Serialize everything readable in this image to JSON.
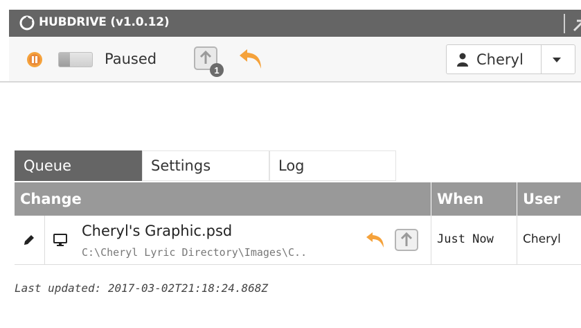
{
  "app": {
    "title": "HUBDRIVE (v1.0.12)"
  },
  "toolbar": {
    "status": "Paused",
    "upload_badge_count": "1",
    "user_name": "Cheryl"
  },
  "tabs": [
    {
      "label": "Queue",
      "active": true
    },
    {
      "label": "Settings",
      "active": false
    },
    {
      "label": "Log",
      "active": false
    }
  ],
  "table": {
    "columns": [
      "Change",
      "When",
      "User"
    ],
    "rows": [
      {
        "file_name": "Cheryl's Graphic.psd",
        "file_path": "C:\\Cheryl Lyric Directory\\Images\\C..",
        "when": "Just Now",
        "user": "Cheryl"
      }
    ]
  },
  "footer": {
    "last_updated": "Last updated: 2017-03-02T21:18:24.868Z"
  },
  "colors": {
    "titlebar": "#656565",
    "accent_orange": "#f5a23b",
    "table_header": "#999999"
  },
  "icons": [
    "hubdrive-logo-icon",
    "expand-icon",
    "pause-icon",
    "upload-icon",
    "undo-icon",
    "person-icon",
    "chevron-down-icon",
    "pencil-icon",
    "monitor-icon"
  ]
}
